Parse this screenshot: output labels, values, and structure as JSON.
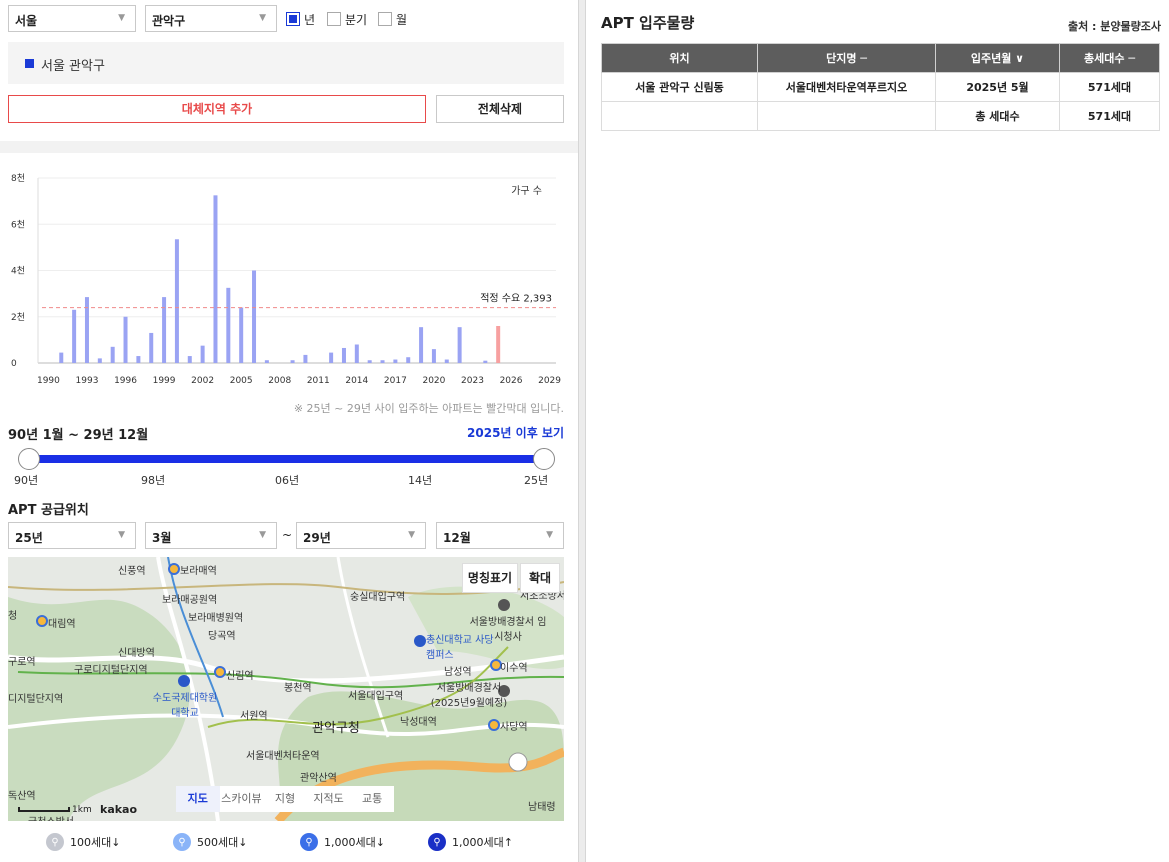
{
  "filters": {
    "city": "서울",
    "district": "관악구",
    "period_options": [
      {
        "label": "년",
        "checked": true
      },
      {
        "label": "분기",
        "checked": false
      },
      {
        "label": "월",
        "checked": false
      }
    ]
  },
  "region_chip": "서울 관악구",
  "buttons": {
    "add_region": "대체지역 추가",
    "delete_all": "전체삭제"
  },
  "chart_data": {
    "type": "bar",
    "series_label": "가구 수",
    "y_ticks": [
      "0",
      "2천",
      "4천",
      "6천",
      "8천"
    ],
    "ylim": [
      0,
      8000
    ],
    "x_ticks": [
      "1990",
      "1993",
      "1996",
      "1999",
      "2002",
      "2005",
      "2008",
      "2011",
      "2014",
      "2017",
      "2020",
      "2023",
      "2026",
      "2029"
    ],
    "xlim": [
      1989.5,
      2029.5
    ],
    "years": [
      1991,
      1992,
      1993,
      1994,
      1995,
      1996,
      1997,
      1998,
      1999,
      2000,
      2001,
      2002,
      2003,
      2004,
      2005,
      2006,
      2007,
      2009,
      2010,
      2012,
      2013,
      2014,
      2015,
      2016,
      2017,
      2018,
      2019,
      2020,
      2021,
      2022,
      2023,
      2024,
      2025
    ],
    "values": [
      450,
      2300,
      2850,
      200,
      700,
      2000,
      300,
      1300,
      2850,
      5350,
      300,
      750,
      7250,
      3250,
      2400,
      4000,
      120,
      120,
      350,
      450,
      650,
      800,
      120,
      120,
      150,
      250,
      1550,
      600,
      150,
      1550,
      0,
      100,
      1600
    ],
    "highlight_from_year": 2025,
    "reference_value": 2393,
    "reference_label": "적정 수요 2,393",
    "colors": {
      "bar": "#9aa3f3",
      "highlight": "#f7a0a0",
      "reference": "#f08a8a"
    }
  },
  "chart_note": "※ 25년 ~ 29년 사이 입주하는 아파트는 빨간막대 입니다.",
  "range": {
    "title": "90년 1월 ~ 29년 12월",
    "link": "2025년 이후 보기",
    "ticks": [
      "90년",
      "98년",
      "06년",
      "14년",
      "25년"
    ]
  },
  "supply": {
    "title": "APT 공급위치",
    "from_year": "25년",
    "from_month": "3월",
    "tilde": "~",
    "to_year": "29년",
    "to_month": "12월"
  },
  "map": {
    "btn_names": "명칭표기",
    "btn_zoom": "확대",
    "tabs": [
      "지도",
      "스카이뷰",
      "지형",
      "지적도",
      "교통"
    ],
    "active_tab": "지도",
    "scale": "1km",
    "brand": "kakao",
    "labels": {
      "sinpung": "신풍역",
      "boramae": "보라매역",
      "boramae_park": "보라매공원역",
      "boramae_hosp": "보라매병원역",
      "daerim": "대림역",
      "danggok": "당곡역",
      "sindaebang": "신대방역",
      "guro_digital": "구로디지털단지역",
      "sillim": "신림역",
      "sudo": "수도국제대학원 대학교",
      "seowon": "서원역",
      "bongcheon": "봉천역",
      "seoul_univ_ent": "서울대입구역",
      "soongsil": "숭실대입구역",
      "chongshin": "총신대학교 사당캠퍼스",
      "namseong": "남성역",
      "isu": "이수역",
      "court1": "서울방배경찰서 임시청사",
      "court2": "서울방배경찰서 (2025년9월예정)",
      "nakseongdae": "낙성대역",
      "sadang": "사당역",
      "gwanak_office": "관악구청",
      "seoul_venture": "서울대벤처타운역",
      "gwanaksan": "관악산역",
      "seocho": "서초소방서",
      "namtae": "남태령",
      "doksan": "독산역",
      "guro_fire": "금천소방서",
      "edge_cheong": "청",
      "edge_guro": "구로역",
      "edge_digital": "디지털단지역"
    }
  },
  "legend": [
    "100세대↓",
    "500세대↓",
    "1,000세대↓",
    "1,000세대↑"
  ],
  "right": {
    "title": "APT 입주물량",
    "source": "출처 : 분양물량조사",
    "headers": [
      "위치",
      "단지명 ─",
      "입주년월 ∨",
      "총세대수 ─"
    ],
    "rows": [
      [
        "서울 관악구 신림동",
        "서울대벤처타운역푸르지오",
        "2025년 5월",
        "571세대"
      ],
      [
        "",
        "",
        "총 세대수",
        "571세대"
      ]
    ]
  }
}
